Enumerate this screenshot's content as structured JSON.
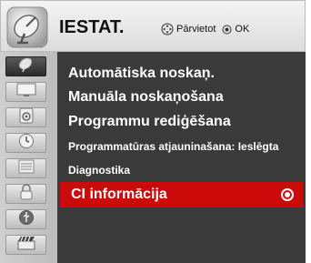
{
  "header": {
    "title": "IESTAT.",
    "hint_move": "Pārvietot",
    "hint_ok": "OK"
  },
  "sidebar": {
    "items": [
      {
        "icon": "satellite-dish-icon",
        "active": true
      },
      {
        "icon": "tv-screen-icon",
        "active": false
      },
      {
        "icon": "speaker-icon",
        "active": false
      },
      {
        "icon": "clock-icon",
        "active": false
      },
      {
        "icon": "options-icon",
        "active": false
      },
      {
        "icon": "lock-icon",
        "active": false
      },
      {
        "icon": "usb-icon",
        "active": false
      },
      {
        "icon": "movie-clapper-icon",
        "active": false
      }
    ]
  },
  "menu": {
    "items": [
      {
        "label": "Automātiska noskaņ."
      },
      {
        "label": "Manuāla noskaņošana"
      },
      {
        "label": "Programmu rediģēšana"
      },
      {
        "label": "Programmatūras atjauninašana: Ieslēgta"
      },
      {
        "label": "Diagnostika"
      },
      {
        "label": "CI informācija",
        "selected": true
      }
    ]
  },
  "colors": {
    "panel_bg": "#3a3a3a",
    "selected_bg": "#cc0a0a",
    "header_bg": "#e6e6e6"
  }
}
